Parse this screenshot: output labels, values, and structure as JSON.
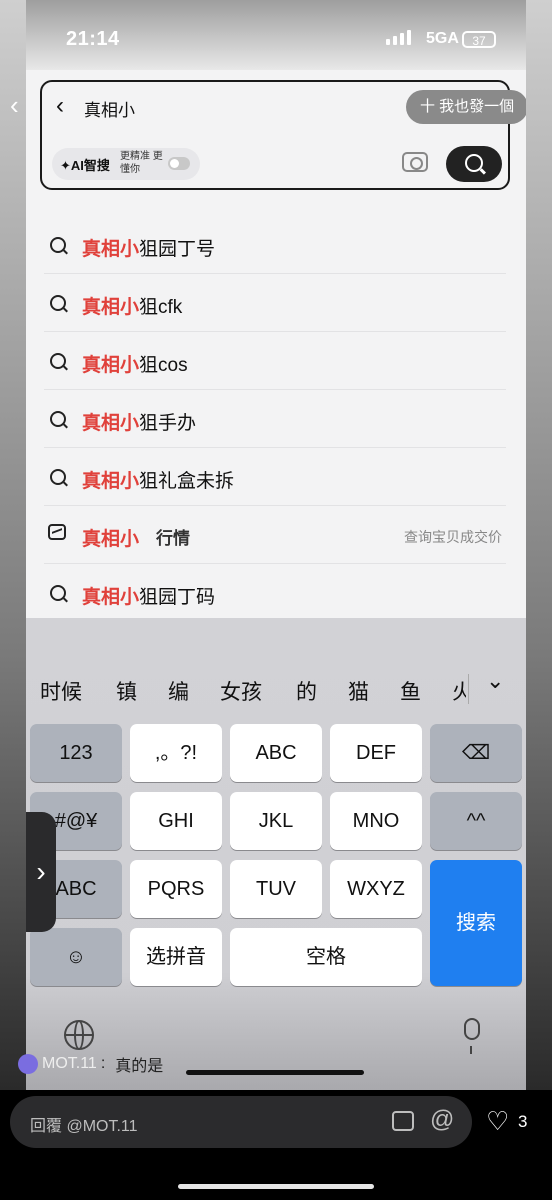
{
  "status_bar": {
    "time": "21:14",
    "network": "5GA",
    "battery": "37"
  },
  "search": {
    "query": "真相小",
    "post_button": "十 我也發一個",
    "ai_label": "✦AI智搜",
    "ai_hint": "更精准 更懂你"
  },
  "suggestions": [
    {
      "highlight": "真相小",
      "rest": "狙园丁号",
      "icon": "search-icon"
    },
    {
      "highlight": "真相小",
      "rest": "狙cfk",
      "icon": "search-icon"
    },
    {
      "highlight": "真相小",
      "rest": "狙cos",
      "icon": "search-icon"
    },
    {
      "highlight": "真相小",
      "rest": "狙手办",
      "icon": "search-icon"
    },
    {
      "highlight": "真相小",
      "rest": "狙礼盒未拆",
      "icon": "search-icon"
    },
    {
      "highlight": "真相小",
      "tag": "行情",
      "right": "查询宝贝成交价",
      "icon": "trend-chart-icon"
    },
    {
      "highlight": "真相小",
      "rest": "狙园丁码",
      "icon": "search-icon"
    }
  ],
  "keyboard": {
    "candidates": [
      "时候",
      "镇",
      "编",
      "女孩",
      "的",
      "猫",
      "鱼",
      "火"
    ],
    "keys": {
      "num": "123",
      "punct": ",。?!",
      "abc": "ABC",
      "def": "DEF",
      "sym": "#@¥",
      "ghi": "GHI",
      "jkl": "JKL",
      "mno": "MNO",
      "emoticon": "^^",
      "abc_switch": "ABC",
      "pqrs": "PQRS",
      "tuv": "TUV",
      "wxyz": "WXYZ",
      "pinyin": "选拼音",
      "space": "空格",
      "search": "搜索"
    }
  },
  "comment": {
    "user": "MOT.11",
    "text": "真的是"
  },
  "reply_bar": {
    "placeholder": "回覆 @MOT.11",
    "likes": "3"
  }
}
